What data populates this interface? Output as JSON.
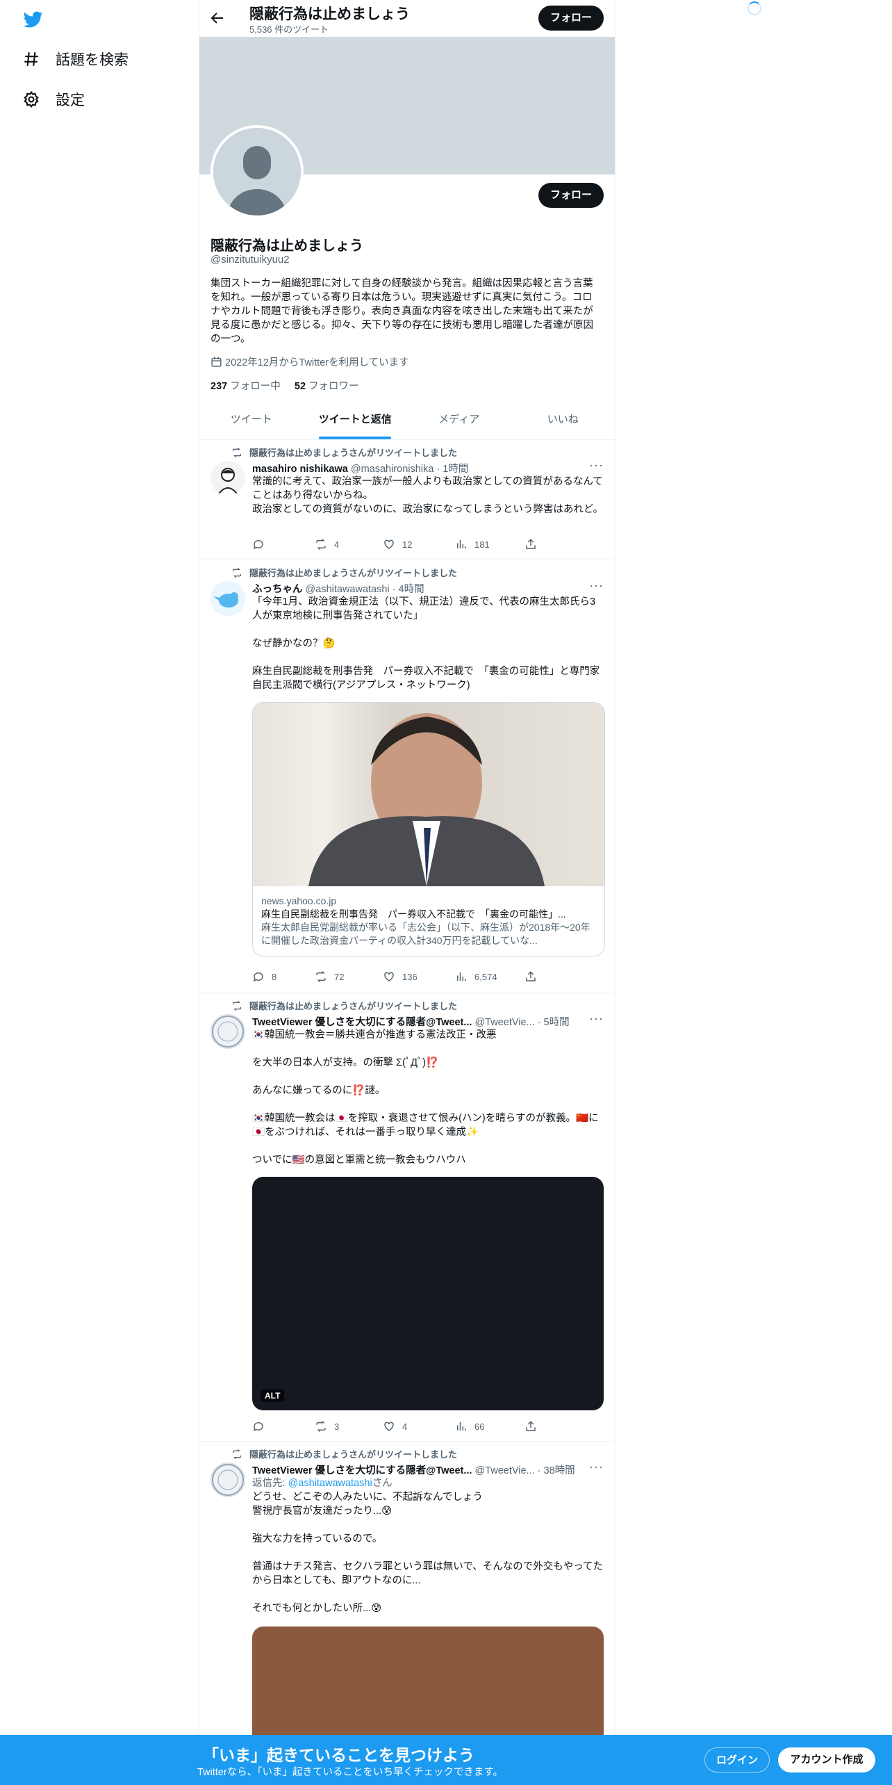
{
  "sidebar": {
    "items": [
      {
        "label": "話題を検索",
        "icon": "hashtag-icon"
      },
      {
        "label": "設定",
        "icon": "gear-icon"
      }
    ]
  },
  "header": {
    "title": "隠蔽行為は止めましょう",
    "tweet_count": "5,536 件のツイート",
    "follow_label": "フォロー"
  },
  "profile": {
    "name": "隠蔽行為は止めましょう",
    "handle": "@sinzitutuikyuu2",
    "bio": "集団ストーカー組織犯罪に対して自身の経験談から発言。組織は因果応報と言う言葉を知れ。一般が思っている寄り日本は危うい。現実逃避せずに真実に気付こう。コロナやカルト問題で背後も浮き彫り。表向き真面な内容を呟き出した末端も出て来たが見る度に愚かだと感じる。抑々、天下り等の存在に技術も悪用し暗躍した者達が原因の一つ。",
    "joined": "2022年12月からTwitterを利用しています",
    "following_count": "237",
    "following_label": "フォロー中",
    "followers_count": "52",
    "followers_label": "フォロワー",
    "follow_label": "フォロー"
  },
  "tabs": [
    {
      "label": "ツイート"
    },
    {
      "label": "ツイートと返信",
      "active": true
    },
    {
      "label": "メディア"
    },
    {
      "label": "いいね"
    }
  ],
  "tweets": [
    {
      "retweeted_by": "隠蔽行為は止めましょうさんがリツイートしました",
      "name": "masahiro nishikawa",
      "handle": "@masahironishika",
      "time": "· 1時間",
      "body": "常識的に考えて、政治家一族が一般人よりも政治家としての資質があるなんてことはあり得ないからね。\n政治家としての資質がないのに、政治家になってしまうという弊害はあれど。",
      "replies": "",
      "retweets": "4",
      "likes": "12",
      "views": "181"
    },
    {
      "retweeted_by": "隠蔽行為は止めましょうさんがリツイートしました",
      "name": "ふっちゃん",
      "handle": "@ashitawawatashi",
      "time": "· 4時間",
      "body": "「今年1月、政治資金規正法（以下、規正法）違反で、代表の麻生太郎氏ら3人が東京地検に刑事告発されていた」\n\nなぜ静かなの？🤔\n\n麻生自民副総裁を刑事告発　パー券収入不記載で　「裏金の可能性」と専門家　自民主派閥で横行(アジアプレス・ネットワーク)",
      "card": {
        "domain": "news.yahoo.co.jp",
        "title": "麻生自民副総裁を刑事告発　パー券収入不記載で　「裏金の可能性」...",
        "desc": "麻生太郎自民党副総裁が率いる「志公会」（以下、麻生派）が2018年～20年に開催した政治資金パーティの収入計340万円を記載していな..."
      },
      "replies": "8",
      "retweets": "72",
      "likes": "136",
      "views": "6,574"
    },
    {
      "retweeted_by": "隠蔽行為は止めましょうさんがリツイートしました",
      "name": "TweetViewer 優しさを大切にする隠者@Tweet...",
      "handle": "@TweetVie...",
      "time": "· 5時間",
      "body": "🇰🇷韓国統一教会＝勝共連合が推進する憲法改正・改悪\n\nを大半の日本人が支持。の衝撃 Σ(ﾟДﾟ)⁉️\n\nあんなに嫌ってるのに⁉️謎。\n\n🇰🇷韓国統一教会は🇯🇵を搾取・衰退させて恨み(ハン)を晴らすのが教義。🇨🇳に🇯🇵をぶつければ、それは一番手っ取り早く達成✨\n\nついでに🇺🇸の意図と軍需と統一教会もウハウハ",
      "media_alt": "ALT",
      "replies": "",
      "retweets": "3",
      "likes": "4",
      "views": "66"
    },
    {
      "retweeted_by": "隠蔽行為は止めましょうさんがリツイートしました",
      "name": "TweetViewer 優しさを大切にする隠者@Tweet...",
      "handle": "@TweetVie...",
      "time": "· 38時間",
      "reply_prefix": "返信先: ",
      "reply_to": "@ashitawawatashi",
      "reply_suffix": "さん",
      "body": "どうせ、どこぞの人みたいに、不起訴なんでしょう\n警視庁長官が友達だったり...😰\n\n強大な力を持っているので。\n\n普通はナチス発言、セクハラ罪という罪は無いで、そんなので外交もやってたから日本としても、即アウトなのに...\n\nそれでも何とかしたい所...😰"
    }
  ],
  "bottom_bar": {
    "title": "「いま」起きていることを見つけよう",
    "subtitle": "Twitterなら、「いま」起きていることをいち早くチェックできます。",
    "login": "ログイン",
    "signup": "アカウント作成"
  },
  "colors": {
    "accent": "#1d9bf0",
    "banner": "#cfd9de",
    "dark_button": "#0f1419"
  }
}
